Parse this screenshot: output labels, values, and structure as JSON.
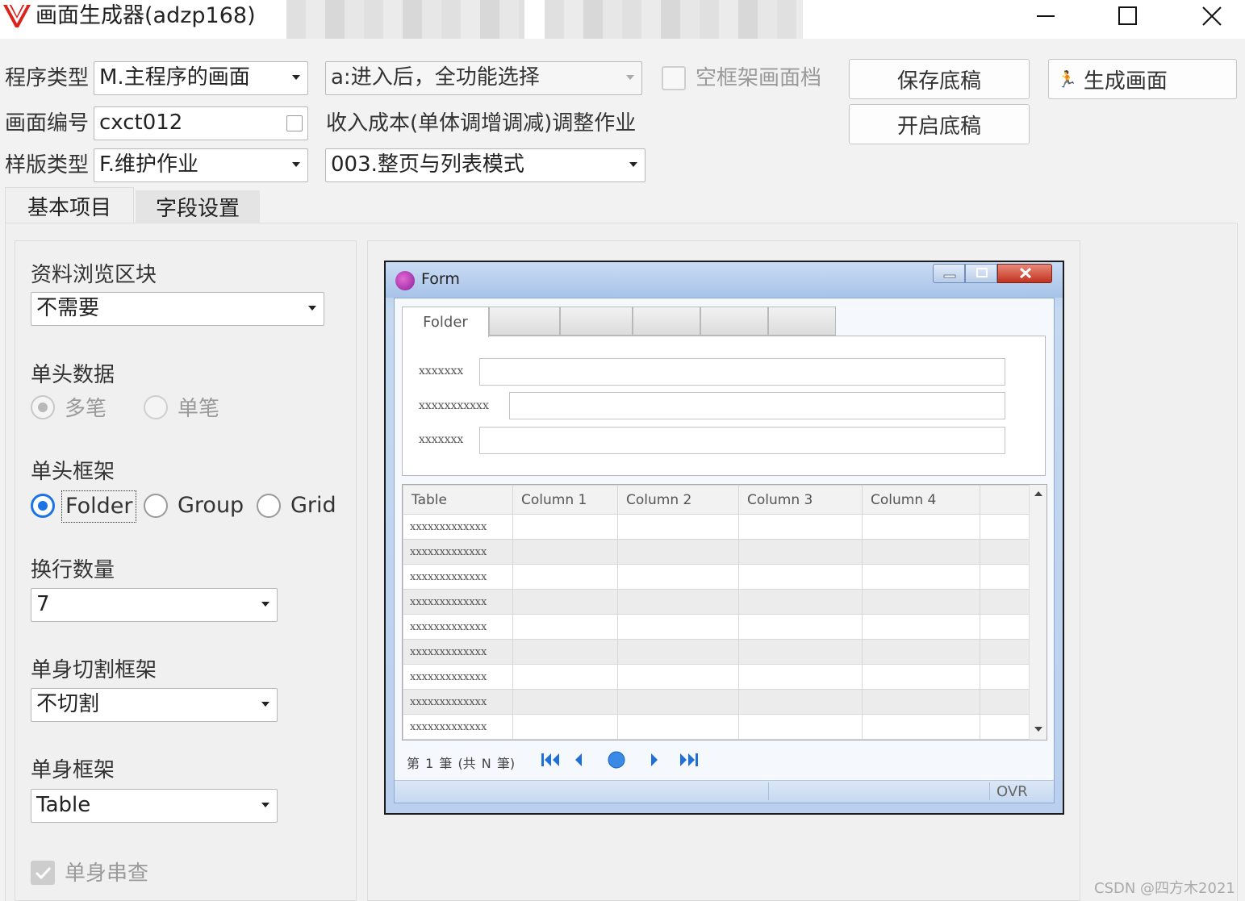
{
  "window": {
    "title": "画面生成器(adzp168)",
    "controls": [
      "minimize-icon",
      "maximize-icon",
      "close-icon"
    ]
  },
  "top": {
    "program_type_label": "程序类型",
    "program_type_value": "M.主程序的画面",
    "entry_option_value": "a:进入后，全功能选择",
    "empty_frame_label": "空框架画面档",
    "empty_frame_checked": false,
    "save_draft_label": "保存底稿",
    "generate_label": "生成画面",
    "screen_no_label": "画面编号",
    "screen_no_value": "cxct012",
    "screen_desc": "收入成本(单体调增调减)调整作业",
    "open_draft_label": "开启底稿",
    "template_type_label": "样版类型",
    "template_type_value": "F.维护作业",
    "template_mode_value": "003.整页与列表模式"
  },
  "tabs": [
    {
      "label": "基本项目",
      "active": true
    },
    {
      "label": "字段设置",
      "active": false
    }
  ],
  "left_panel": {
    "browse_block_label": "资料浏览区块",
    "browse_block_value": "不需要",
    "header_data_label": "单头数据",
    "header_data_options": [
      "多笔",
      "单笔"
    ],
    "header_data_selected": "多笔",
    "header_frame_label": "单头框架",
    "header_frame_options": [
      "Folder",
      "Group",
      "Grid"
    ],
    "header_frame_selected": "Folder",
    "wrap_count_label": "换行数量",
    "wrap_count_value": "7",
    "body_split_label": "单身切割框架",
    "body_split_value": "不切割",
    "body_frame_label": "单身框架",
    "body_frame_value": "Table",
    "body_query_label": "单身串查",
    "body_query_checked": true
  },
  "preview": {
    "title": "Form",
    "folder_tab": "Folder",
    "fields": [
      "xxxxxxx",
      "xxxxxxxxxxx",
      "xxxxxxx"
    ],
    "table_header": [
      "Table",
      "Column 1",
      "Column 2",
      "Column 3",
      "Column 4"
    ],
    "row_text": "xxxxxxxxxxxxx",
    "row_count": 9,
    "nav_text": "第 1 筆 (共 N 筆)",
    "status_text": "OVR"
  },
  "watermark": "CSDN @四方木2021",
  "colors": {
    "accent_blue": "#1a73e8",
    "form_frame": "#bad0ee",
    "nav_blue": "#1f6fd6"
  }
}
